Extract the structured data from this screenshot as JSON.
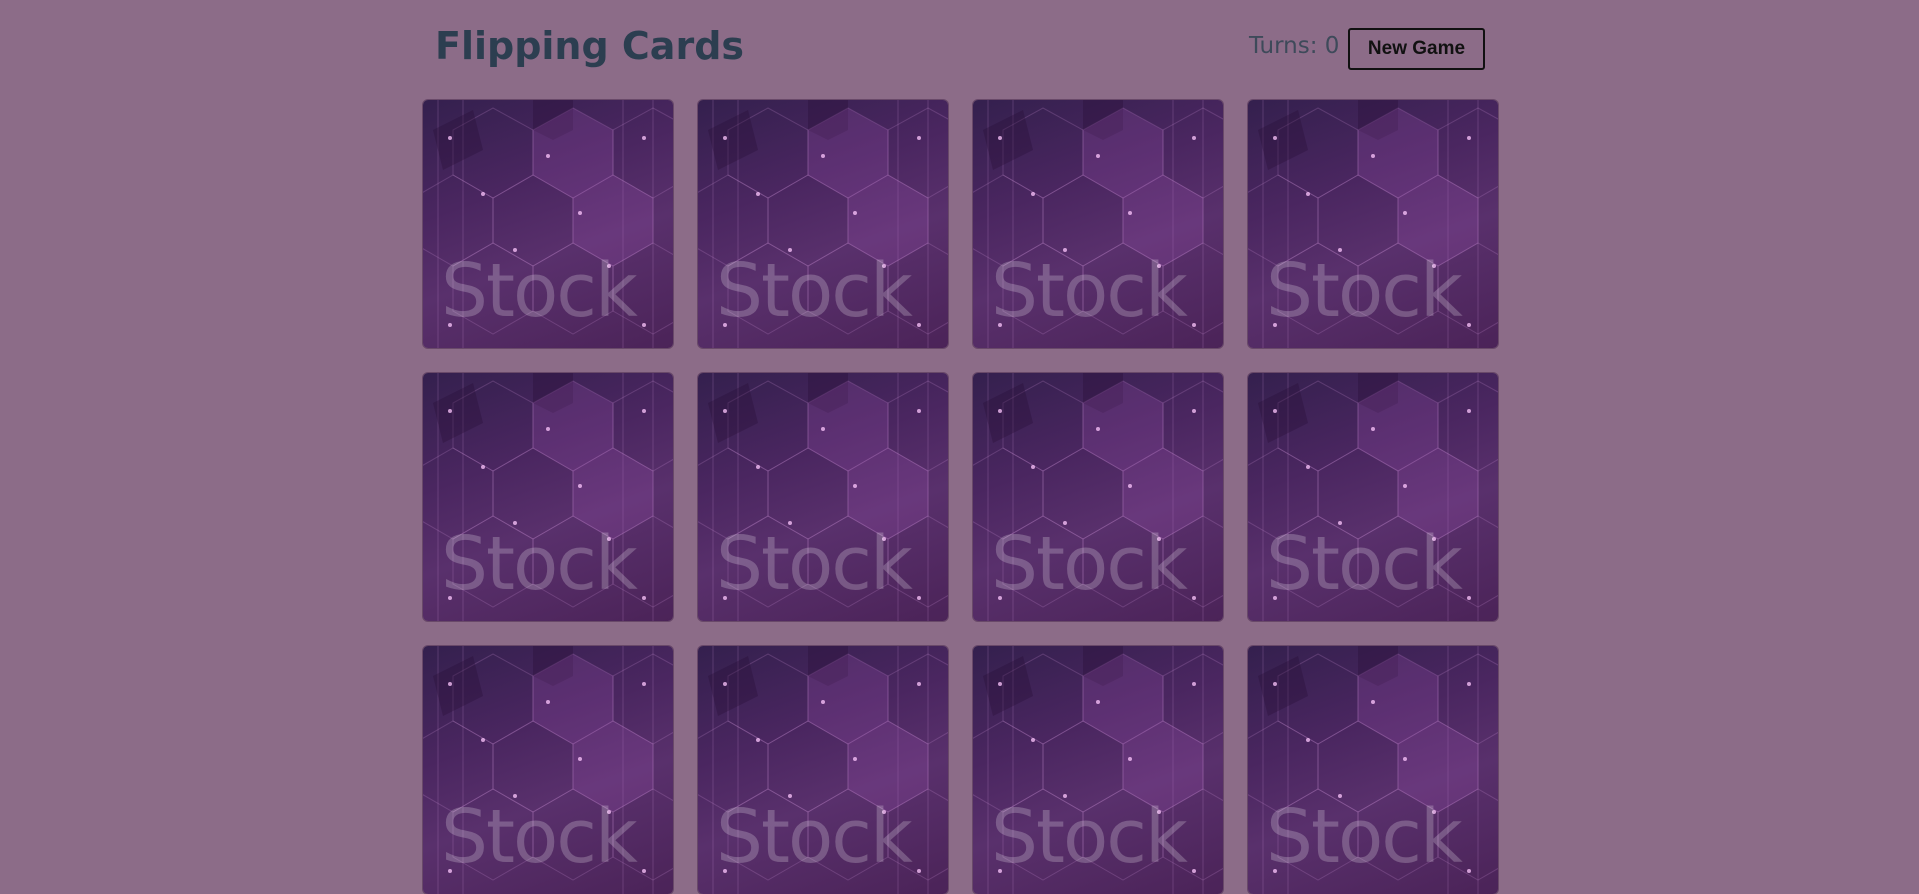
{
  "header": {
    "title": "Flipping Cards",
    "turns_label": "Turns: 0",
    "new_game_label": "New Game"
  },
  "cards": {
    "count": 12,
    "columns": 4,
    "state": "face-down",
    "back_watermark": "Stock",
    "back_colors": [
      "#34204e",
      "#59306c"
    ]
  },
  "colors": {
    "page_background": "#8c6c88",
    "title": "#2c3e50"
  }
}
